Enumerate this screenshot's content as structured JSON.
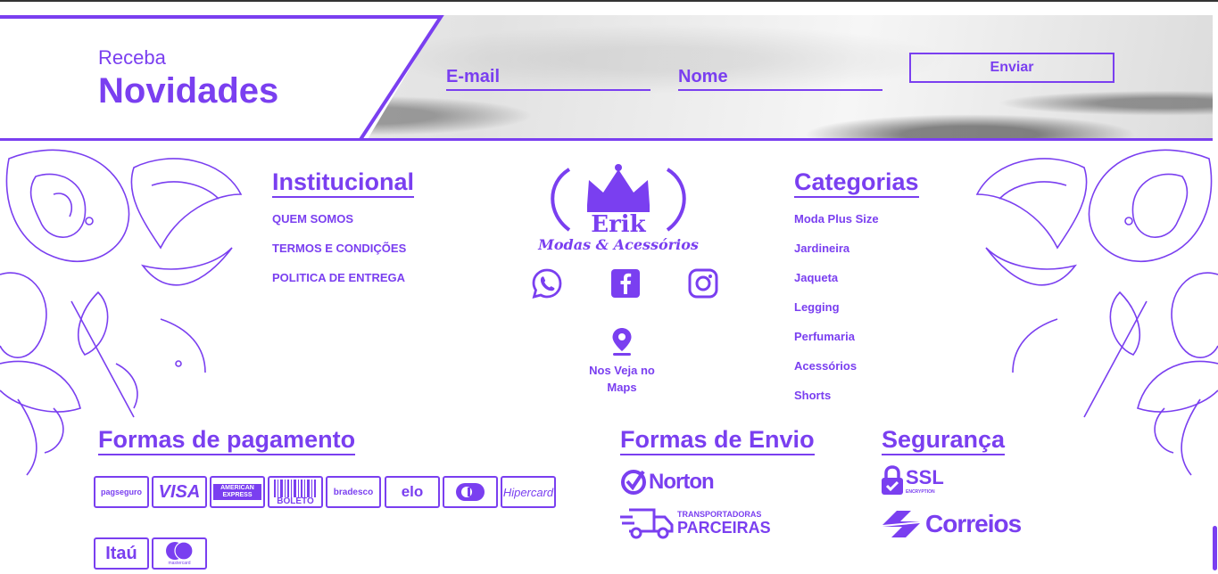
{
  "newsletter": {
    "small_title": "Receba",
    "big_title": "Novidades",
    "email_placeholder": "E-mail",
    "name_placeholder": "Nome",
    "submit_label": "Enviar"
  },
  "institucional": {
    "title": "Institucional",
    "links": [
      "QUEM SOMOS",
      "TERMOS E CONDIÇÕES",
      "POLITICA DE ENTREGA"
    ]
  },
  "brand": {
    "name": "Erik",
    "tagline": "Modas & Acessórios",
    "maps_label_line1": "Nos Veja no",
    "maps_label_line2": "Maps"
  },
  "social_icons": [
    "whatsapp-icon",
    "facebook-icon",
    "instagram-icon"
  ],
  "categorias": {
    "title": "Categorias",
    "links": [
      "Moda Plus Size",
      "Jardineira",
      "Jaqueta",
      "Legging",
      "Perfumaria",
      "Acessórios",
      "Shorts"
    ]
  },
  "pagamento": {
    "title": "Formas de pagamento",
    "methods": [
      "pagseguro",
      "VISA",
      "AMERICAN EXPRESS",
      "BOLETO",
      "bradesco",
      "elo",
      "Diners",
      "Hipercard",
      "Itaú",
      "mastercard"
    ]
  },
  "envio": {
    "title": "Formas de Envio",
    "norton": "Norton",
    "transportadoras_small": "TRANSPORTADORAS",
    "transportadoras_big": "PARCEIRAS"
  },
  "seguranca": {
    "title": "Segurança",
    "ssl": "SSL",
    "ssl_sub": "ENCRYPTION",
    "correios": "Correios"
  },
  "colors": {
    "accent": "#7a3ff0",
    "background": "#ffffff"
  }
}
